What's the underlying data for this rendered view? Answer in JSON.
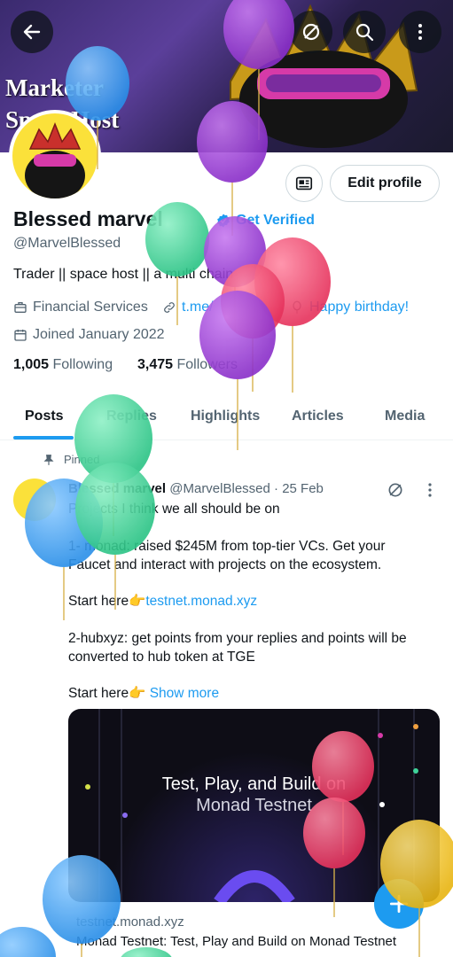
{
  "banner": {
    "line1": "Marketer",
    "line2": "Space Host"
  },
  "profile": {
    "name": "Blessed marvel",
    "get_verified": "Get Verified",
    "handle": "@MarvelBlessed",
    "bio": "Trader || space host || a multi chain",
    "category": "Financial Services",
    "link": "t.me/",
    "birthday": "Happy birthday!",
    "joined": "Joined January 2022",
    "following_count": "1,005",
    "following_label": "Following",
    "followers_count": "3,475",
    "followers_label": "Followers",
    "edit_profile": "Edit profile"
  },
  "tabs": [
    "Posts",
    "Replies",
    "Highlights",
    "Articles",
    "Media"
  ],
  "post": {
    "pinned_label": "Pinned",
    "author": "Blessed marvel",
    "handle": "@MarvelBlessed",
    "date": "· 25 Feb",
    "line1": "Projects I think we all should be on",
    "line2": "1- monad: raised $245M from top-tier VCs. Get your",
    "line3": "Faucet and interact with projects on the ecosystem.",
    "start_here": "Start here👉",
    "link1": "testnet.monad.xyz",
    "line4": "2-hubxyz: get points from your replies and points will be",
    "line5": "converted to hub token at TGE",
    "show_more": "Show more",
    "card_title_1": "Test, Play, and Build on",
    "card_title_2": "Monad Testnet",
    "card_domain": "testnet.monad.xyz",
    "card_desc": "Monad Testnet: Test, Play and Build on Monad Testnet"
  },
  "colors": {
    "accent": "#1d9bf0",
    "balloon_purple": "#9b3bd6",
    "balloon_green": "#3fd39a",
    "balloon_red": "#f0436a",
    "balloon_blue": "#3aa0f2",
    "balloon_yellow": "#f2c21b"
  },
  "icons": {
    "back": "arrow-left-icon",
    "hide": "eye-off-icon",
    "search": "search-icon",
    "more": "more-vertical-icon",
    "subscribe": "newsletter-icon",
    "verified": "verified-badge-icon",
    "briefcase": "briefcase-icon",
    "link": "link-icon",
    "balloon": "balloon-icon",
    "calendar": "calendar-icon",
    "pin": "pin-icon",
    "fab": "plus-icon"
  }
}
